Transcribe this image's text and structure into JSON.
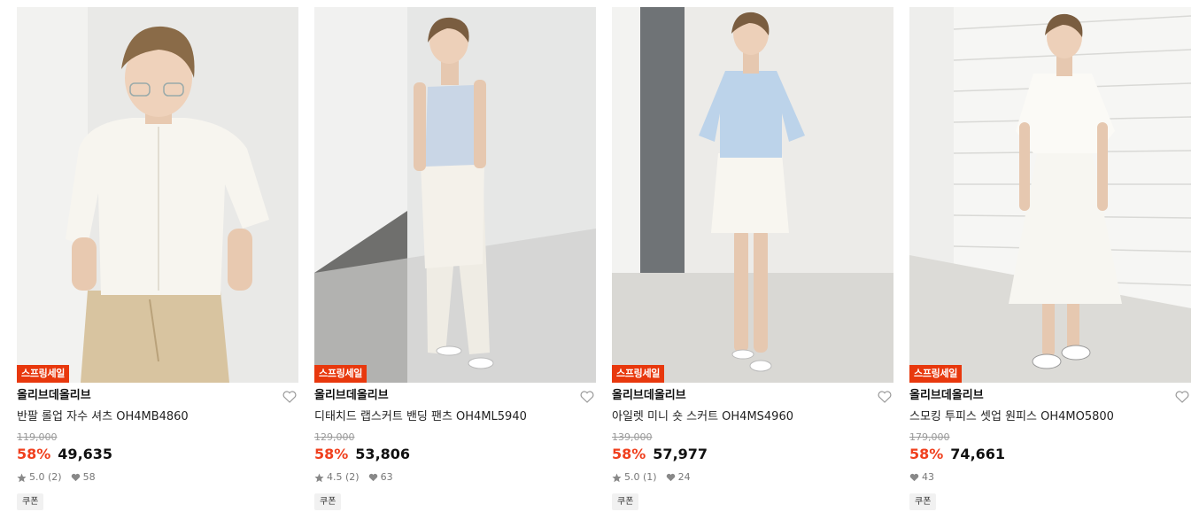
{
  "products": [
    {
      "badge": "스프링세일",
      "brand": "올리브데올리브",
      "name": "반팔 롤업 자수 셔츠 OH4MB4860",
      "original_price": "119,000",
      "discount": "58%",
      "price": "49,635",
      "rating": "5.0 (2)",
      "likes": "58",
      "coupon": "쿠폰"
    },
    {
      "badge": "스프링세일",
      "brand": "올리브데올리브",
      "name": "디태치드 랩스커트 밴딩 팬츠 OH4ML5940",
      "original_price": "129,000",
      "discount": "58%",
      "price": "53,806",
      "rating": "4.5 (2)",
      "likes": "63",
      "coupon": "쿠폰"
    },
    {
      "badge": "스프링세일",
      "brand": "올리브데올리브",
      "name": "아일렛 미니 숏 스커트 OH4MS4960",
      "original_price": "139,000",
      "discount": "58%",
      "price": "57,977",
      "rating": "5.0 (1)",
      "likes": "24",
      "coupon": "쿠폰"
    },
    {
      "badge": "스프링세일",
      "brand": "올리브데올리브",
      "name": "스모킹 투피스 셋업 원피스 OH4MO5800",
      "original_price": "179,000",
      "discount": "58%",
      "price": "74,661",
      "rating": "",
      "likes": "43",
      "coupon": "쿠폰"
    }
  ],
  "colors": {
    "badge_bg": "#e8380d",
    "discount": "#f0401e"
  }
}
